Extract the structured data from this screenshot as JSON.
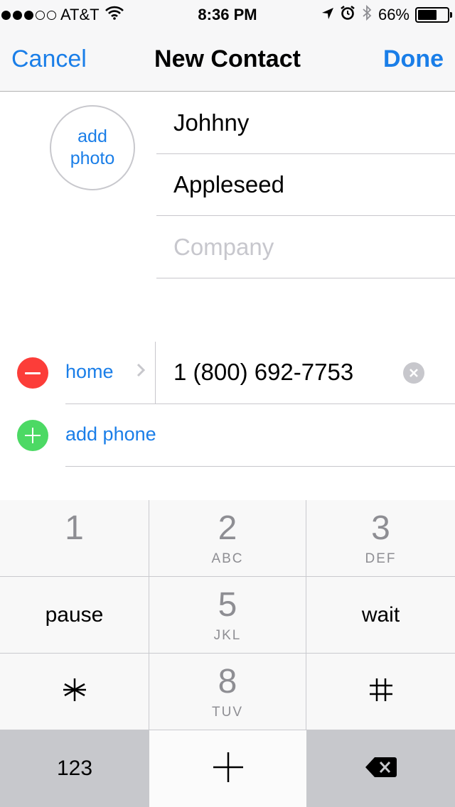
{
  "status_bar": {
    "signal_filled": 3,
    "signal_total": 5,
    "carrier": "AT&T",
    "time": "8:36 PM",
    "battery_text": "66%",
    "battery_level": 0.66,
    "icons": [
      "wifi-icon",
      "location-arrow-icon",
      "alarm-icon",
      "bluetooth-icon",
      "battery-icon"
    ]
  },
  "nav": {
    "cancel_label": "Cancel",
    "title": "New Contact",
    "done_label": "Done"
  },
  "photo": {
    "line1": "add",
    "line2": "photo"
  },
  "fields": {
    "first_name": "Johhny",
    "last_name": "Appleseed",
    "company_placeholder": "Company"
  },
  "phone": {
    "label": "home",
    "number": "1 (800) 692-7753",
    "add_label": "add phone"
  },
  "keypad": {
    "keys": [
      {
        "digit": "1",
        "letters": ""
      },
      {
        "digit": "2",
        "letters": "ABC"
      },
      {
        "digit": "3",
        "letters": "DEF"
      },
      {
        "word": "pause"
      },
      {
        "digit": "5",
        "letters": "JKL"
      },
      {
        "word": "wait"
      },
      {
        "symbol": "asterisk"
      },
      {
        "digit": "8",
        "letters": "TUV"
      },
      {
        "symbol": "hash"
      },
      {
        "word": "123"
      },
      {
        "symbol": "plus"
      },
      {
        "symbol": "delete"
      }
    ]
  },
  "colors": {
    "accent": "#1a7ee8",
    "destructive": "#fc3d39",
    "add": "#4cd964",
    "separator": "#c8c7cc"
  }
}
